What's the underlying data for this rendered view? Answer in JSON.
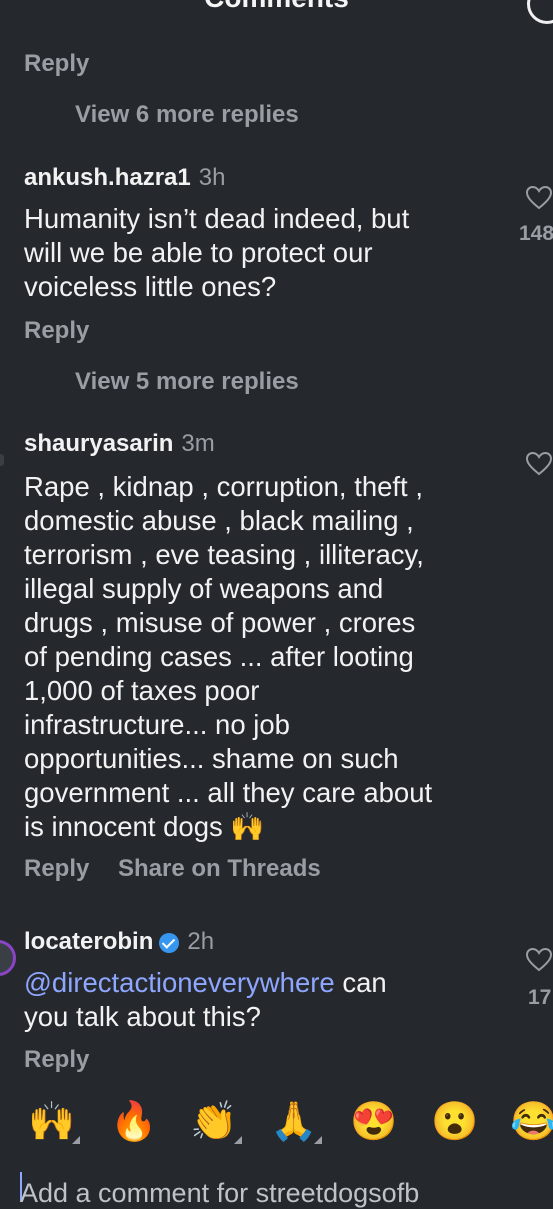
{
  "header": {
    "title": "Comments"
  },
  "comments": [
    {
      "reply": "Reply",
      "view_more": "View 6 more replies"
    },
    {
      "username": "ankush.hazra1",
      "time": "3h",
      "lines": [
        "Humanity isn’t dead indeed, but",
        "will we be able to protect our",
        "voiceless little ones?"
      ],
      "likes": "148",
      "reply": "Reply",
      "view_more": "View 5 more replies"
    },
    {
      "username": "shauryasarin",
      "time": "3m",
      "lines": [
        "Rape , kidnap , corruption,  theft ,",
        "domestic abuse , black mailing ,",
        "terrorism , eve teasing , illiteracy,",
        "illegal supply of weapons and",
        "drugs , misuse of power , crores",
        "of pending cases ... after looting",
        "1,000 of taxes poor",
        "infrastructure... no job",
        "opportunities... shame on such",
        "government ... all they care about",
        "is innocent dogs 🙌"
      ],
      "reply": "Reply",
      "share": "Share on Threads"
    },
    {
      "username": "locaterobin",
      "time": "2h",
      "mention": "@directactioneverywhere",
      "line1_rest": " can",
      "line2": "you talk about this?",
      "likes": "17",
      "reply": "Reply"
    }
  ],
  "emoji_bar": [
    "🙌",
    "🔥",
    "👏",
    "🙏",
    "😍",
    "😮",
    "😂"
  ],
  "input": {
    "placeholder": "Add a comment for streetdogsofb"
  }
}
